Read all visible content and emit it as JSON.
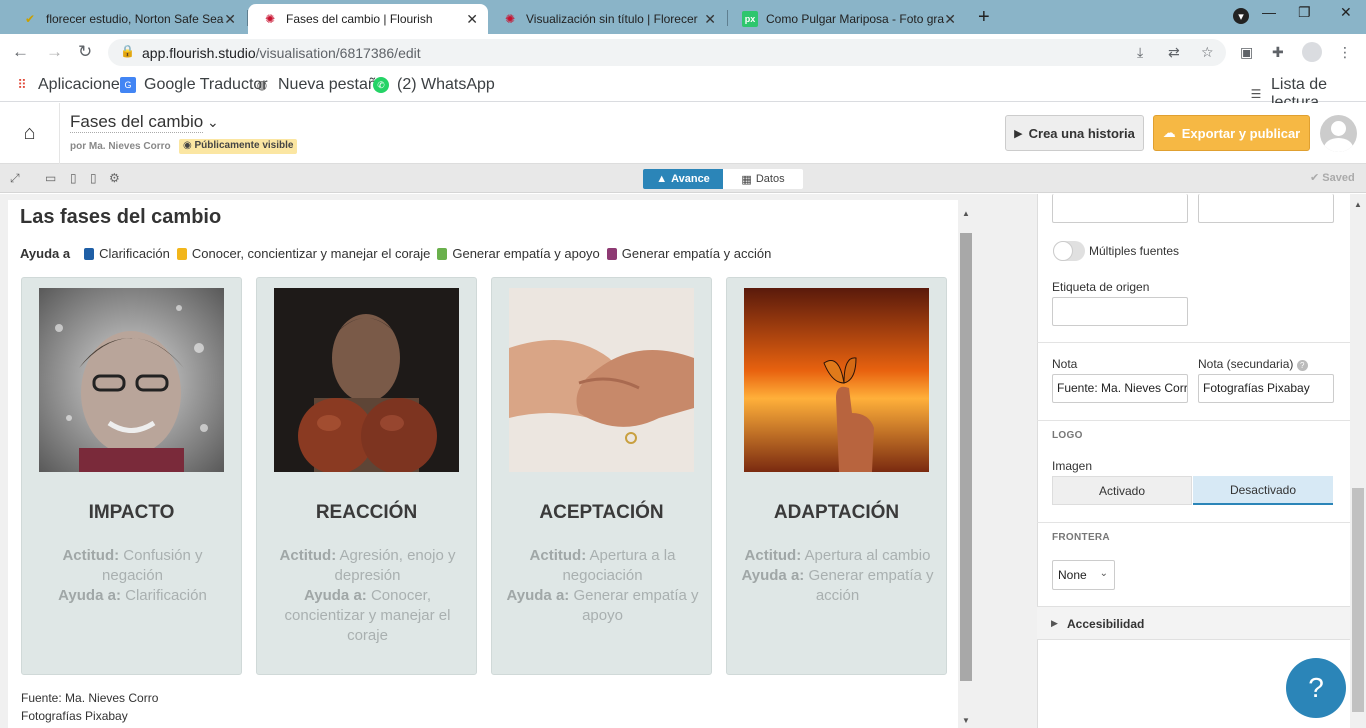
{
  "browser": {
    "tabs": [
      {
        "title": "florecer estudio, Norton Safe Sea",
        "icon": "norton-check-icon"
      },
      {
        "title": "Fases del cambio | Flourish",
        "icon": "flourish-icon",
        "active": true
      },
      {
        "title": "Visualización sin título | Florecer",
        "icon": "flourish-icon"
      },
      {
        "title": "Como Pulgar Mariposa - Foto gra",
        "icon": "pixabay-icon"
      }
    ],
    "url_host": "app.flourish.studio",
    "url_path": "/visualisation/6817386/edit",
    "bookmarks": [
      "Aplicaciones",
      "Google Traductor",
      "Nueva pestaña",
      "(2) WhatsApp"
    ],
    "reading_list": "Lista de lectura"
  },
  "header": {
    "title": "Fases del cambio",
    "byline": "por Ma. Nieves Corro",
    "visibility": "Públicamente visible",
    "story_button": "Crea una historia",
    "export_button": "Exportar y publicar"
  },
  "editor": {
    "tab_preview": "Avance",
    "tab_data": "Datos",
    "saved": "Saved"
  },
  "preview": {
    "title": "Las fases del cambio",
    "legend_heading": "Ayuda a",
    "legend": [
      {
        "label": "Clarificación",
        "color": "#1f5fa6"
      },
      {
        "label": "Conocer, concientizar y manejar el coraje",
        "color": "#f2b61b"
      },
      {
        "label": "Generar empatía y apoyo",
        "color": "#6ab04c"
      },
      {
        "label": "Generar empatía y acción",
        "color": "#8e3a73"
      }
    ],
    "cards": [
      {
        "title": "IMPACTO",
        "attitude_label": "Actitud:",
        "attitude": "Confusión y negación",
        "help_label": "Ayuda a:",
        "help": "Clarificación"
      },
      {
        "title": "REACCIÓN",
        "attitude_label": "Actitud:",
        "attitude": "Agresión, enojo y depresión",
        "help_label": "Ayuda a:",
        "help": "Conocer, concientizar y manejar el coraje"
      },
      {
        "title": "ACEPTACIÓN",
        "attitude_label": "Actitud:",
        "attitude": "Apertura a la negociación",
        "help_label": "Ayuda a:",
        "help": "Generar empatía y apoyo"
      },
      {
        "title": "ADAPTACIÓN",
        "attitude_label": "Actitud:",
        "attitude": "Apertura al cambio",
        "help_label": "Ayuda a:",
        "help": "Generar empatía y acción"
      }
    ],
    "footer_source": "Fuente: Ma. Nieves Corro",
    "footer_secondary": "Fotografías Pixabay"
  },
  "panel": {
    "multiple_sources_label": "Múltiples fuentes",
    "source_label_label": "Etiqueta de origen",
    "source_label_value": "",
    "note_label": "Nota",
    "note_value": "Fuente:  Ma. Nieves Corr",
    "note_secondary_label": "Nota (secundaria)",
    "note_secondary_value": "Fotografías Pixabay",
    "logo_section": "LOGO",
    "image_label": "Imagen",
    "image_on": "Activado",
    "image_off": "Desactivado",
    "border_section": "FRONTERA",
    "border_value": "None",
    "accessibility": "Accesibilidad"
  },
  "help_button": "?"
}
